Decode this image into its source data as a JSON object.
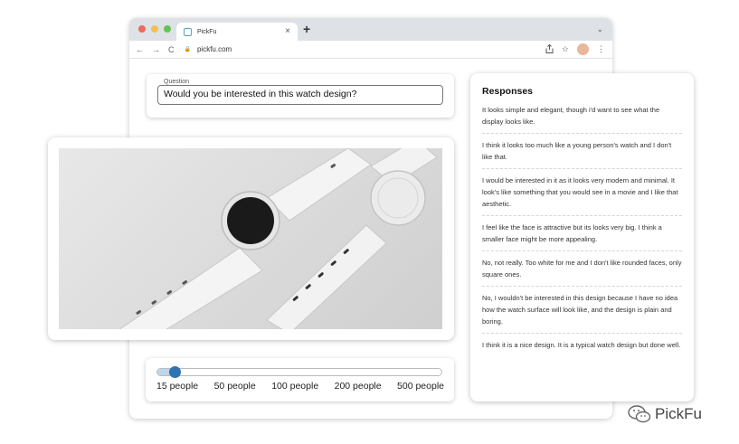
{
  "colors": {
    "traffic_red": "#ec6a5e",
    "traffic_yellow": "#f4bf4f",
    "traffic_green": "#61c554",
    "slider_thumb": "#2f73b3",
    "slider_fill": "#bcd6ea"
  },
  "browser": {
    "tab_title": "PickFu",
    "tab_close": "×",
    "new_tab": "+",
    "tab_menu": "⌄",
    "nav_back": "←",
    "nav_forward": "→",
    "nav_reload": "C",
    "url": "pickfu.com",
    "icons": [
      "share-icon",
      "star-icon",
      "avatar",
      "menu-kebab-icon"
    ]
  },
  "question": {
    "legend": "Question",
    "value": "Would you be interested in this watch design?"
  },
  "slider": {
    "ticks": [
      "15 people",
      "50 people",
      "100 people",
      "200 people",
      "500 people"
    ],
    "selected": "15 people",
    "value_fraction": 0.07
  },
  "responses": {
    "title": "Responses",
    "items": [
      "It looks simple and elegant, though i'd want to see what the display looks like.",
      "I think it looks too much like a young person's watch and I don't like that.",
      "I would be interested in it as it looks very modern and minimal. It look's like something that you would see in a movie and I like that aesthetic.",
      "I feel like the face is attractive but its looks very big. I think a smaller face might be more appealing.",
      "No, not really. Too white for me and I don't like rounded faces, only square ones.",
      "No, I wouldn't be interested in this design because I have no idea how the watch surface will look like, and the design is plain and boring.",
      "I think it is a nice design. It is a typical watch design but done well."
    ]
  },
  "brand": {
    "name": "PickFu"
  }
}
